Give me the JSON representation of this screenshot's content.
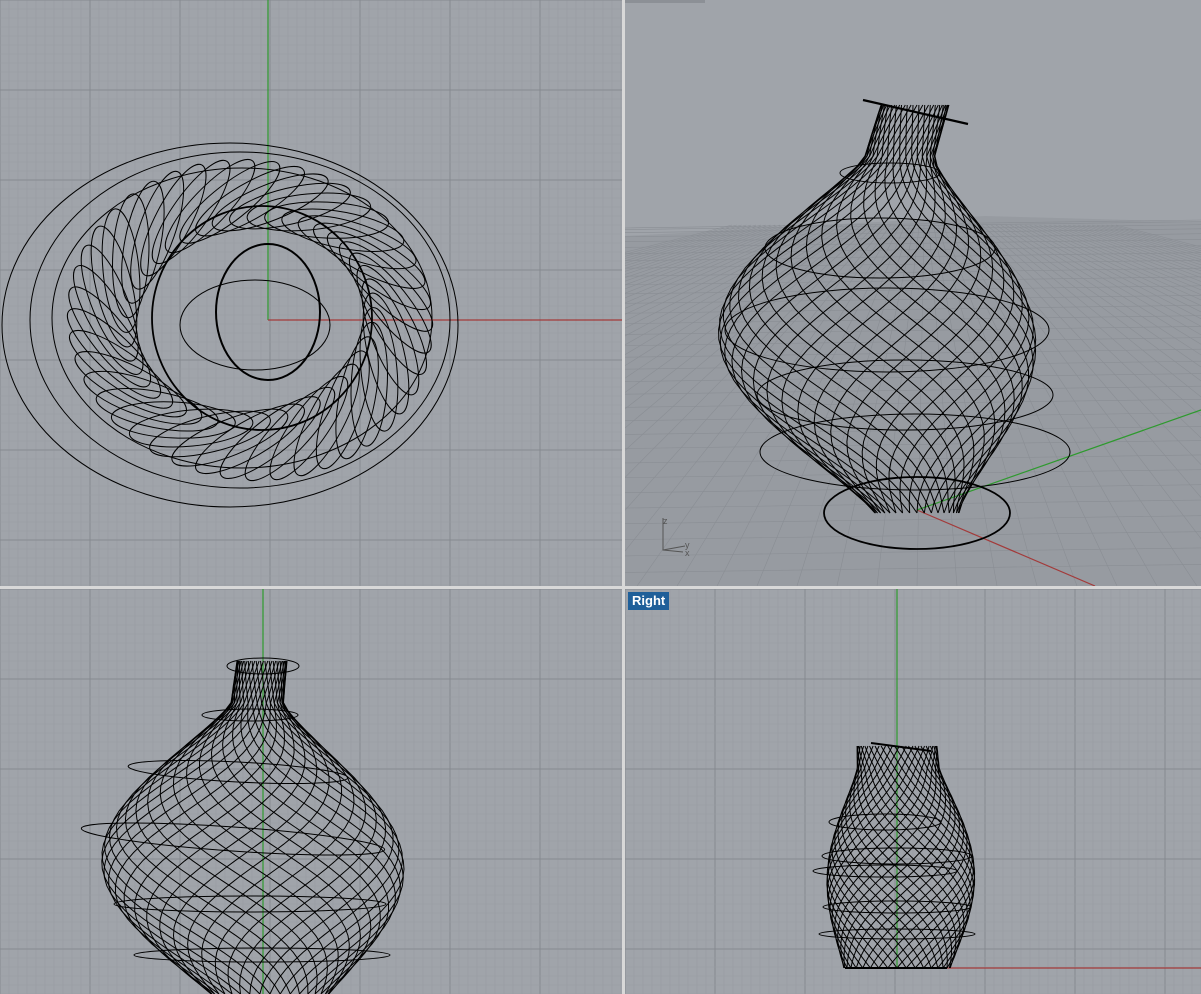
{
  "viewports": {
    "top": {
      "label": ""
    },
    "perspective": {
      "label": "",
      "axis_icon": {
        "z": "z",
        "y": "y",
        "x": "x"
      }
    },
    "front": {
      "label": ""
    },
    "right": {
      "label": "Right"
    }
  },
  "colors": {
    "viewport_bg": "#a0a4aa",
    "minor_grid": "#979ba1",
    "major_grid": "#868a90",
    "x_axis": "#a33a3a",
    "y_axis": "#2e9a2e",
    "curves": "#000000",
    "label_bg": "#1f5f99"
  }
}
